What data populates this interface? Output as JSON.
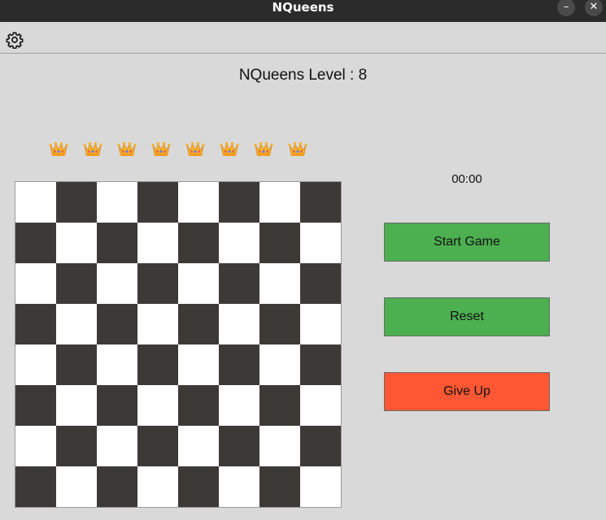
{
  "window": {
    "title": "NQueens",
    "minimize_glyph": "–",
    "close_glyph": "✕"
  },
  "toolbar": {
    "settings_icon": "gear-icon"
  },
  "game": {
    "level_title": "NQueens Level : 8",
    "queens_available": 8,
    "board_size": 8,
    "timer": "00:00"
  },
  "buttons": {
    "start": "Start Game",
    "reset": "Reset",
    "give_up": "Give Up"
  },
  "colors": {
    "light_square": "#ffffff",
    "dark_square": "#3b3a36",
    "start_button": "#4caf50",
    "reset_button": "#4caf50",
    "give_up_button": "#ff5733",
    "background": "#d9d9d9"
  }
}
